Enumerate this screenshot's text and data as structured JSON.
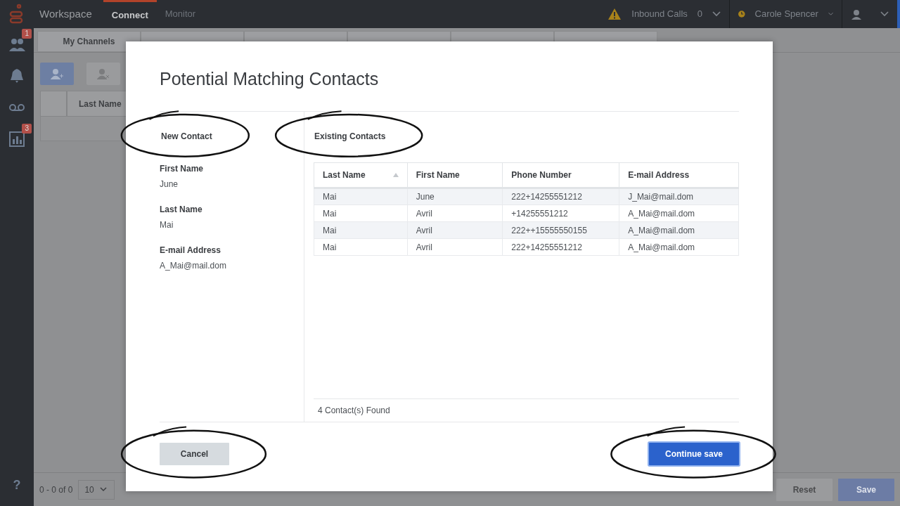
{
  "header": {
    "app_name": "Workspace",
    "nav": [
      {
        "label": "Connect",
        "selected": true
      },
      {
        "label": "Monitor",
        "selected": false
      }
    ],
    "inbound_label": "Inbound Calls",
    "inbound_count": "0",
    "user": "Carole Spencer"
  },
  "sidebar": {
    "items": [
      {
        "kind": "contacts",
        "badge": "1"
      },
      {
        "kind": "alerts"
      },
      {
        "kind": "voicemail"
      },
      {
        "kind": "reports",
        "badge": "3"
      }
    ],
    "help": "?"
  },
  "background": {
    "tabs": [
      {
        "label": "My Channels"
      }
    ],
    "table_header": "Last Name",
    "pager_range": "0 - 0 of 0",
    "page_size": "10",
    "buttons": [
      {
        "label": "Reset",
        "kind": "secondary"
      },
      {
        "label": "Save",
        "kind": "primary"
      }
    ]
  },
  "modal": {
    "title": "Potential Matching Contacts",
    "new_contact": {
      "heading": "New Contact",
      "circled": true,
      "fields": [
        {
          "label": "First Name",
          "value": "June"
        },
        {
          "label": "Last Name",
          "value": "Mai"
        },
        {
          "label": "E-mail Address",
          "value": "A_Mai@mail.dom"
        }
      ]
    },
    "existing": {
      "heading": "Existing Contacts",
      "circled": true,
      "columns": [
        {
          "label": "Last Name",
          "sorted": true
        },
        {
          "label": "First Name",
          "sorted": false
        },
        {
          "label": "Phone Number",
          "sorted": false
        },
        {
          "label": "E-mail Address",
          "sorted": false
        }
      ],
      "rows": [
        [
          "Mai",
          "June",
          "222+14255551212",
          "J_Mai@mail.dom"
        ],
        [
          "Mai",
          "Avril",
          "+14255551212",
          "A_Mai@mail.dom"
        ],
        [
          "Mai",
          "Avril",
          "222++15555550155",
          "A_Mai@mail.dom"
        ],
        [
          "Mai",
          "Avril",
          "222+14255551212",
          "A_Mai@mail.dom"
        ]
      ],
      "found": "4 Contact(s) Found"
    },
    "buttons": [
      {
        "label": "Cancel",
        "kind": "secondary",
        "circled": true
      },
      {
        "label": "Continue save",
        "kind": "primary",
        "circled": true
      }
    ]
  }
}
